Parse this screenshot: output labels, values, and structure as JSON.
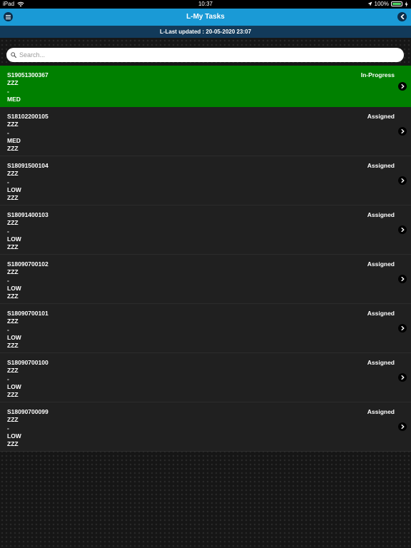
{
  "status_bar": {
    "device": "iPad",
    "time": "10:37",
    "battery": "100%",
    "battery_level": 1.0,
    "icons": [
      "wifi-icon",
      "location-arrow-icon",
      "battery-icon",
      "charging-icon"
    ]
  },
  "nav": {
    "title": "L-My Tasks",
    "menu_icon": "hamburger-menu-icon",
    "back_icon": "chevron-left-icon"
  },
  "subheader": {
    "text": "L-Last updated : 20-05-2020 23:07"
  },
  "search": {
    "placeholder": "Search...",
    "value": "",
    "icon": "search-icon"
  },
  "colors": {
    "nav_bar": "#1a9ad6",
    "subheader": "#123a5a",
    "active_row": "#008000",
    "row": "#202020"
  },
  "tasks": [
    {
      "id": "S19051300367",
      "status": "In-Progress",
      "lines": [
        "ZZZ",
        "-",
        "MED"
      ]
    },
    {
      "id": "S18102200105",
      "status": "Assigned",
      "lines": [
        "ZZZ",
        "-",
        "MED",
        "ZZZ"
      ]
    },
    {
      "id": "S18091500104",
      "status": "Assigned",
      "lines": [
        "ZZZ",
        "-",
        "LOW",
        "ZZZ"
      ]
    },
    {
      "id": "S18091400103",
      "status": "Assigned",
      "lines": [
        "ZZZ",
        "-",
        "LOW",
        "ZZZ"
      ]
    },
    {
      "id": "S18090700102",
      "status": "Assigned",
      "lines": [
        "ZZZ",
        "-",
        "LOW",
        "ZZZ"
      ]
    },
    {
      "id": "S18090700101",
      "status": "Assigned",
      "lines": [
        "ZZZ",
        "-",
        "LOW",
        "ZZZ"
      ]
    },
    {
      "id": "S18090700100",
      "status": "Assigned",
      "lines": [
        "ZZZ",
        "-",
        "LOW",
        "ZZZ"
      ]
    },
    {
      "id": "S18090700099",
      "status": "Assigned",
      "lines": [
        "ZZZ",
        "-",
        "LOW",
        "ZZZ"
      ]
    }
  ]
}
